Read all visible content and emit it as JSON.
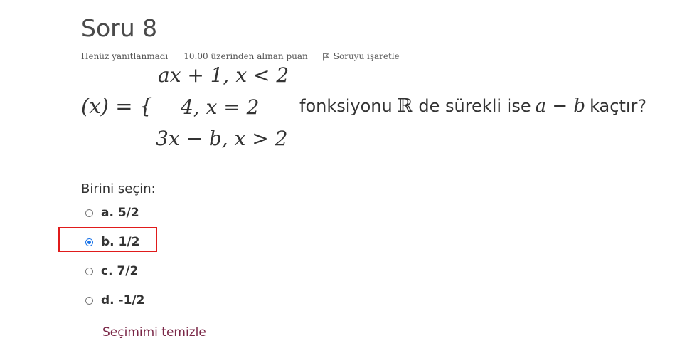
{
  "question": {
    "title": "Soru 8",
    "state": "Henüz yanıtlanmadı",
    "grade": "10.00 üzerinden alınan puan",
    "flag_label": "Soruyu işaretle"
  },
  "formula": {
    "lhs": "(x) = {",
    "case1": "ax + 1, x < 2",
    "case2": "4,  x = 2",
    "case3": "3x − b,  x > 2"
  },
  "text": {
    "part1": "fonksiyonu",
    "reals": "ℝ",
    "part2": "de sürekli ise",
    "expr": "a − b",
    "part3": "kaçtır?"
  },
  "answer": {
    "prompt": "Birini seçin:",
    "options": [
      {
        "label": "a. 5/2",
        "checked": false
      },
      {
        "label": "b. 1/2",
        "checked": true
      },
      {
        "label": "c. 7/2",
        "checked": false
      },
      {
        "label": "d. -1/2",
        "checked": false
      }
    ],
    "clear_label": "Seçimimi temizle"
  },
  "colors": {
    "link": "#7a2747",
    "highlight": "#e01b1b",
    "radio_selected": "#1a73e8"
  }
}
